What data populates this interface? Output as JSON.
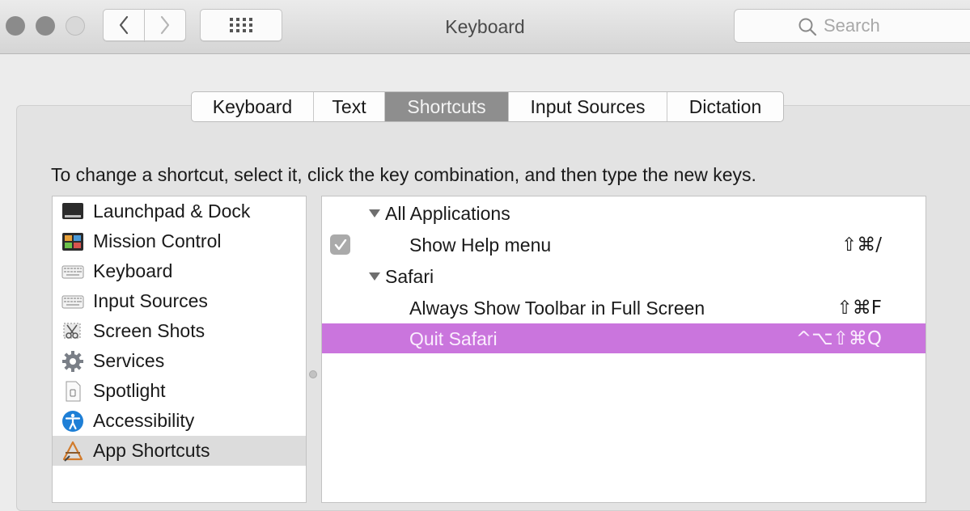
{
  "window": {
    "title": "Keyboard"
  },
  "toolbar": {
    "back_icon": "chevron-left-icon",
    "forward_icon": "chevron-right-icon",
    "show_all_icon": "grid-icon"
  },
  "search": {
    "placeholder": "Search",
    "value": ""
  },
  "tabs": [
    {
      "label": "Keyboard",
      "selected": false
    },
    {
      "label": "Text",
      "selected": false
    },
    {
      "label": "Shortcuts",
      "selected": true
    },
    {
      "label": "Input Sources",
      "selected": false
    },
    {
      "label": "Dictation",
      "selected": false
    }
  ],
  "instructions": "To change a shortcut, select it, click the key combination, and then type the new keys.",
  "categories": [
    {
      "label": "Launchpad & Dock",
      "icon": "launchpad-dock-icon"
    },
    {
      "label": "Mission Control",
      "icon": "mission-control-icon"
    },
    {
      "label": "Keyboard",
      "icon": "keyboard-icon"
    },
    {
      "label": "Input Sources",
      "icon": "input-sources-icon"
    },
    {
      "label": "Screen Shots",
      "icon": "screenshot-icon"
    },
    {
      "label": "Services",
      "icon": "gear-icon"
    },
    {
      "label": "Spotlight",
      "icon": "spotlight-icon"
    },
    {
      "label": "Accessibility",
      "icon": "accessibility-icon"
    },
    {
      "label": "App Shortcuts",
      "icon": "app-shortcuts-icon",
      "selected": true
    }
  ],
  "shortcuts": {
    "group1": {
      "label": "All Applications",
      "expanded": true
    },
    "item1": {
      "label": "Show Help menu",
      "keys": "⇧⌘/",
      "checked": true
    },
    "group2": {
      "label": "Safari",
      "expanded": true
    },
    "item2": {
      "label": "Always Show Toolbar in Full Screen",
      "keys": "⇧⌘F"
    },
    "item3": {
      "label": "Quit Safari",
      "keys": "^⌥⇧⌘Q",
      "selected": true
    }
  },
  "colors": {
    "selection_highlight": "#ca75dd",
    "selected_tab": "#8e8e8e",
    "selected_category": "#dcdcdc"
  }
}
